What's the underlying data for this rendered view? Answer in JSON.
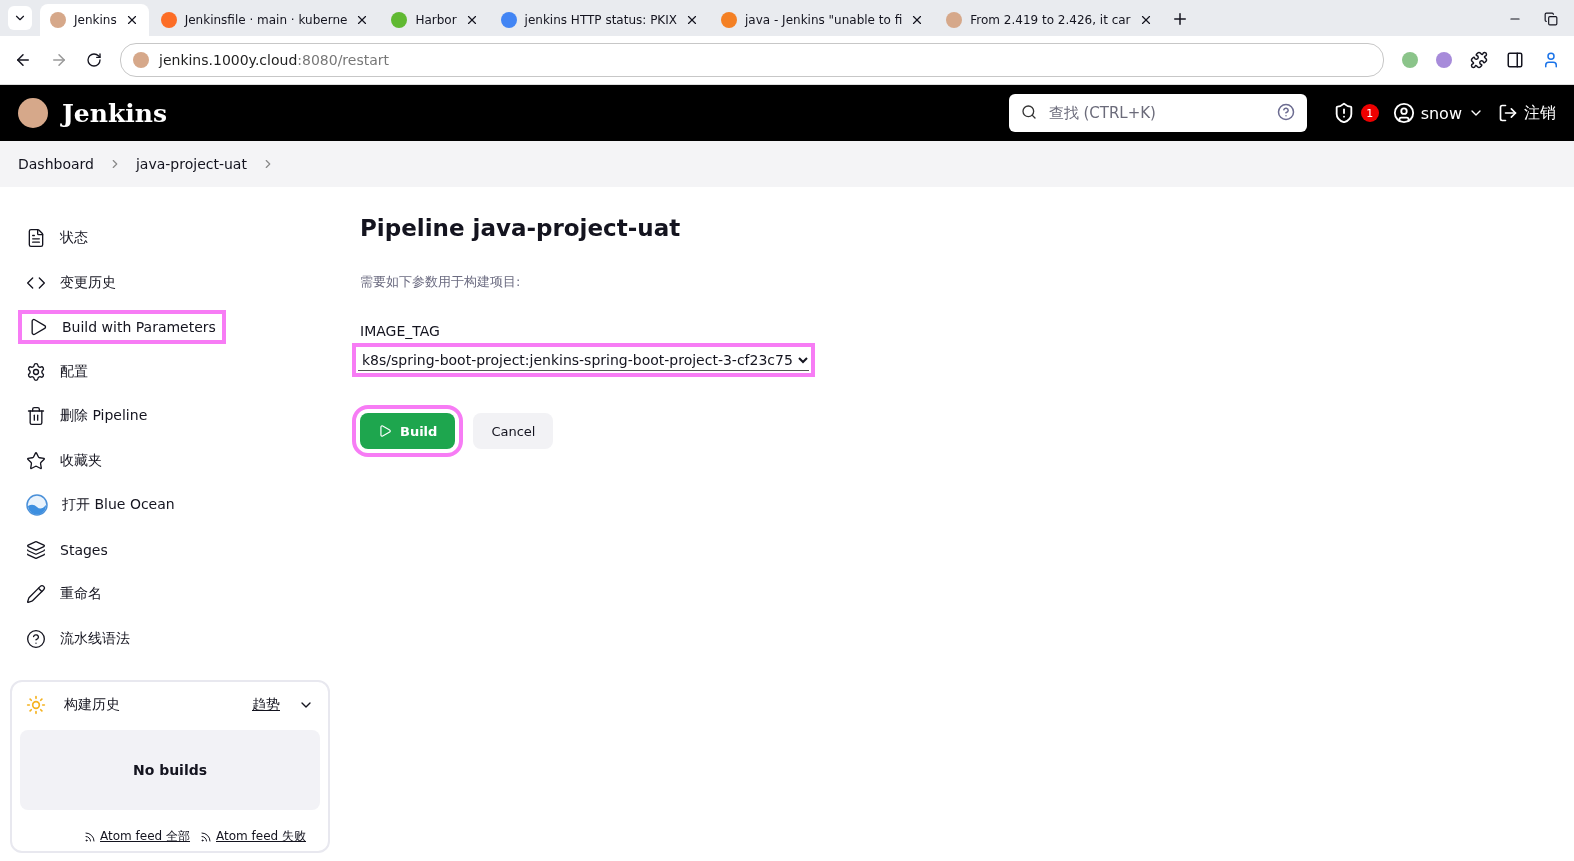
{
  "browser": {
    "tabs": [
      {
        "title": "Jenkins",
        "selected": true
      },
      {
        "title": "Jenkinsfile · main · kuberne",
        "selected": false
      },
      {
        "title": "Harbor",
        "selected": false
      },
      {
        "title": "jenkins HTTP status: PKIX",
        "selected": false
      },
      {
        "title": "java - Jenkins \"unable to fi",
        "selected": false
      },
      {
        "title": "From 2.419 to 2.426, it car",
        "selected": false
      }
    ],
    "url_host": "jenkins.1000y.cloud",
    "url_path": ":8080/restart"
  },
  "header": {
    "logo": "Jenkins",
    "search_placeholder": "查找 (CTRL+K)",
    "alerts": "1",
    "user": "snow",
    "logout": "注销"
  },
  "breadcrumbs": [
    "Dashboard",
    "java-project-uat"
  ],
  "sidebar": {
    "items": [
      {
        "label": "状态",
        "highlighted": false
      },
      {
        "label": "变更历史",
        "highlighted": false
      },
      {
        "label": "Build with Parameters",
        "highlighted": true
      },
      {
        "label": "配置",
        "highlighted": false
      },
      {
        "label": "删除 Pipeline",
        "highlighted": false
      },
      {
        "label": "收藏夹",
        "highlighted": false
      },
      {
        "label": "打开 Blue Ocean",
        "highlighted": false
      },
      {
        "label": "Stages",
        "highlighted": false
      },
      {
        "label": "重命名",
        "highlighted": false
      },
      {
        "label": "流水线语法",
        "highlighted": false
      }
    ]
  },
  "build_history": {
    "title": "构建历史",
    "trend": "趋势",
    "empty": "No builds",
    "feeds": [
      "Atom feed 全部",
      "Atom feed 失败"
    ]
  },
  "main": {
    "title": "Pipeline java-project-uat",
    "intro": "需要如下参数用于构建项目:",
    "parameters": [
      {
        "name": "IMAGE_TAG",
        "value": "k8s/spring-boot-project:jenkins-spring-boot-project-3-cf23c75",
        "highlighted": true
      }
    ],
    "buttons": [
      {
        "label": "Build",
        "kind": "primary",
        "highlighted": true
      },
      {
        "label": "Cancel",
        "kind": "secondary",
        "highlighted": false
      }
    ]
  }
}
